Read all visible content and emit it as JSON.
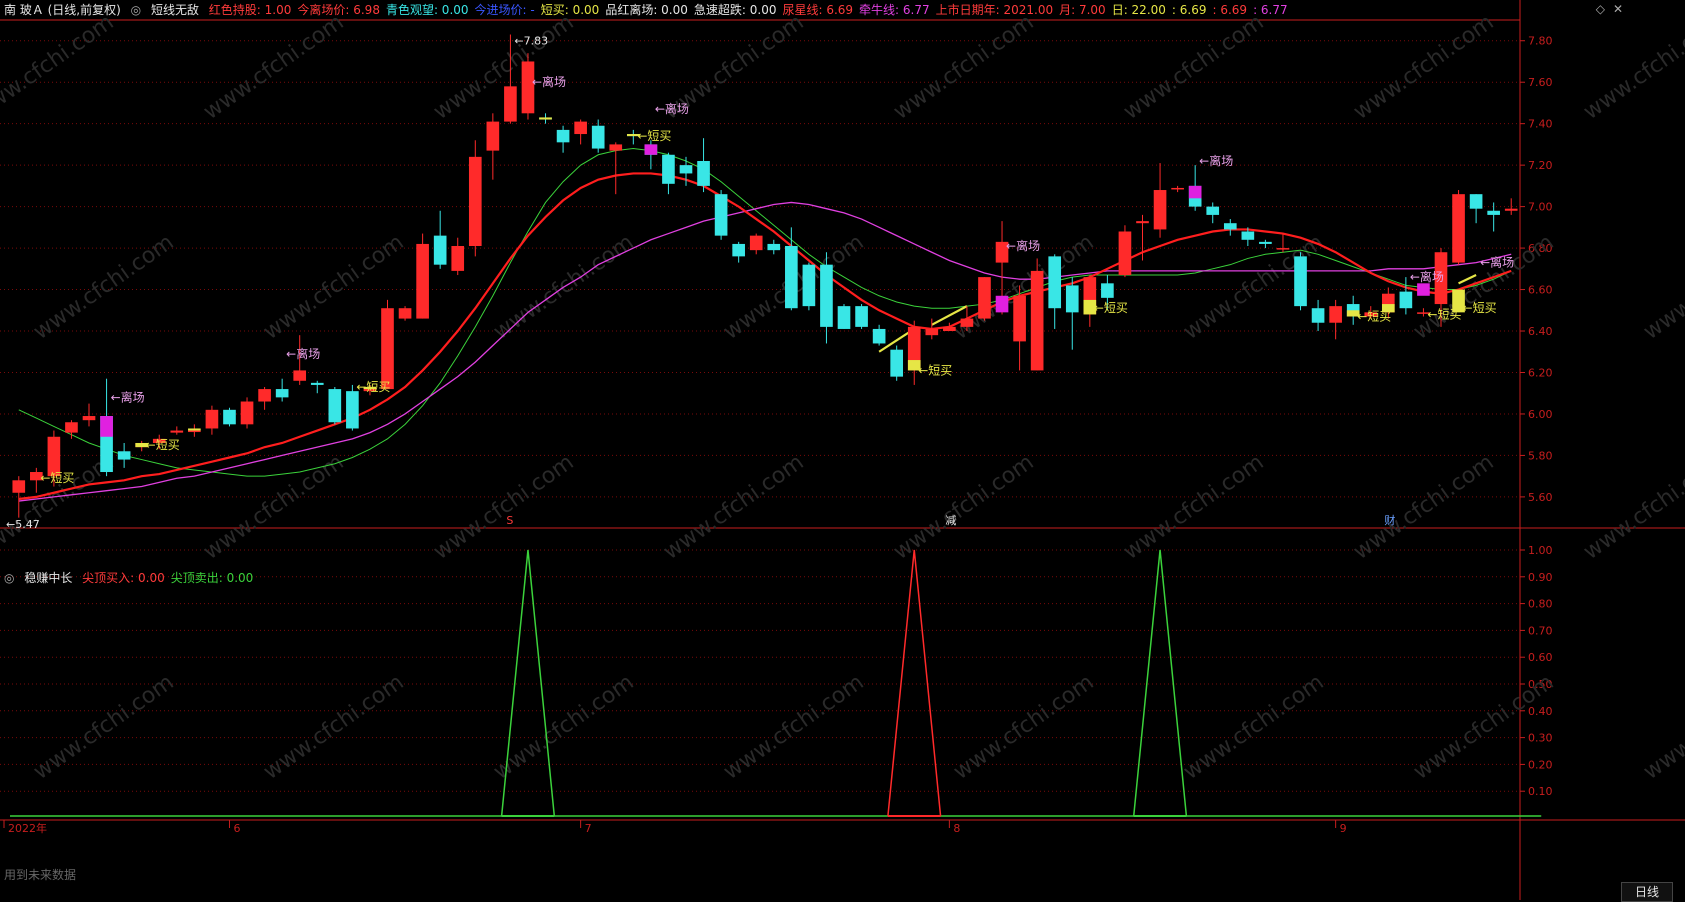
{
  "colors": {
    "bg": "#000000",
    "up": "#ff2a2a",
    "down": "#39e6e6",
    "grid": "#7a0a0a",
    "axis": "#c81e1e",
    "ma_red": "#ff1e1e",
    "ma_magenta": "#e040e0",
    "ma_green": "#3bd23b",
    "gold": "#e6e646",
    "magenta_body": "#e020e0"
  },
  "header": {
    "title": "南 玻Ａ (日线,前复权)",
    "indicator_name": "短线无敌",
    "items": [
      {
        "text": "红色持股: 1.00",
        "color": "#ff3b3b"
      },
      {
        "text": "今离场价: 6.98",
        "color": "#ff3b3b"
      },
      {
        "text": "青色观望: 0.00",
        "color": "#39e6e6"
      },
      {
        "text": "今进场价: -",
        "color": "#3a56ff"
      },
      {
        "text": "短买: 0.00",
        "color": "#e6e646"
      },
      {
        "text": "品红离场: 0.00",
        "color": "#e6e6e6"
      },
      {
        "text": "急速超跌: 0.00",
        "color": "#e6e6e6"
      },
      {
        "text": "尿星线: 6.69",
        "color": "#ff3b3b"
      },
      {
        "text": "牵牛线: 6.77",
        "color": "#e040e0"
      },
      {
        "text": "上市日期年: 2021.00",
        "color": "#ff3b3b"
      },
      {
        "text": "月: 7.00",
        "color": "#ff3b3b"
      },
      {
        "text": "日: 22.00",
        "color": "#e6e646"
      },
      {
        "text": ": 6.69",
        "color": "#e6e646"
      },
      {
        "text": ": 6.69",
        "color": "#ff3b3b"
      },
      {
        "text": ": 6.77",
        "color": "#e040e0"
      }
    ]
  },
  "sub_header": {
    "indicator_name": "稳赚中长",
    "items": [
      {
        "text": "尖顶买入: 0.00",
        "color": "#ff3b3b"
      },
      {
        "text": "尖顶卖出: 0.00",
        "color": "#3bd23b"
      }
    ]
  },
  "main_axis": {
    "ticks": [
      "7.80",
      "7.60",
      "7.40",
      "7.20",
      "7.00",
      "6.80",
      "6.60",
      "6.40",
      "6.20",
      "6.00",
      "5.80",
      "5.60"
    ]
  },
  "sub_axis": {
    "ticks": [
      "1.00",
      "0.90",
      "0.80",
      "0.70",
      "0.60",
      "0.50",
      "0.40",
      "0.30",
      "0.20",
      "0.10"
    ]
  },
  "time_axis": [
    "2022年",
    "6",
    "7",
    "8",
    "9"
  ],
  "period_button": "日线",
  "footer_note": "用到未来数据",
  "watermark": "www.cfchi.com",
  "price_max_label": "7.83",
  "price_min_label": "5.47",
  "event_marks": [
    {
      "text": "S",
      "color": "#ff3b3b"
    },
    {
      "text": "减",
      "color": "#e6e6e6"
    },
    {
      "text": "财",
      "color": "#6aa0ff"
    }
  ],
  "signal_labels": {
    "buy": "←短买",
    "exit": "←离场"
  },
  "chart_data": {
    "type": "candlestick",
    "candles": [
      [
        5.62,
        5.68,
        5.7,
        5.5
      ],
      [
        5.68,
        5.72,
        5.74,
        5.62
      ],
      [
        5.7,
        5.89,
        5.92,
        5.65
      ],
      [
        5.91,
        5.96,
        5.97,
        5.88
      ],
      [
        5.97,
        5.99,
        6.05,
        5.94
      ],
      [
        5.99,
        5.72,
        6.17,
        5.7
      ],
      [
        5.82,
        5.78,
        5.86,
        5.74
      ],
      [
        5.84,
        5.86,
        5.87,
        5.82
      ],
      [
        5.86,
        5.88,
        5.9,
        5.83
      ],
      [
        5.91,
        5.92,
        5.94,
        5.9
      ],
      [
        5.92,
        5.92,
        5.95,
        5.89
      ],
      [
        5.93,
        6.02,
        6.04,
        5.9
      ],
      [
        6.02,
        5.95,
        6.03,
        5.94
      ],
      [
        5.95,
        6.06,
        6.08,
        5.93
      ],
      [
        6.06,
        6.12,
        6.13,
        6.02
      ],
      [
        6.12,
        6.08,
        6.17,
        6.06
      ],
      [
        6.16,
        6.21,
        6.38,
        6.14
      ],
      [
        6.15,
        6.14,
        6.16,
        6.1
      ],
      [
        6.12,
        5.96,
        6.13,
        5.95
      ],
      [
        6.11,
        5.93,
        6.14,
        5.92
      ],
      [
        6.11,
        6.13,
        6.14,
        6.09
      ],
      [
        6.12,
        6.51,
        6.55,
        6.12
      ],
      [
        6.46,
        6.51,
        6.52,
        6.45
      ],
      [
        6.46,
        6.82,
        6.87,
        6.46
      ],
      [
        6.86,
        6.72,
        6.98,
        6.7
      ],
      [
        6.69,
        6.81,
        6.85,
        6.67
      ],
      [
        6.81,
        7.24,
        7.32,
        6.76
      ],
      [
        7.27,
        7.41,
        7.45,
        7.13
      ],
      [
        7.41,
        7.58,
        7.83,
        7.4
      ],
      [
        7.45,
        7.7,
        7.74,
        7.42
      ],
      [
        7.43,
        7.42,
        7.45,
        7.4
      ],
      [
        7.37,
        7.31,
        7.39,
        7.26
      ],
      [
        7.35,
        7.41,
        7.42,
        7.3
      ],
      [
        7.39,
        7.28,
        7.42,
        7.26
      ],
      [
        7.27,
        7.3,
        7.31,
        7.06
      ],
      [
        7.35,
        7.34,
        7.37,
        7.3
      ],
      [
        7.3,
        7.25,
        7.32,
        7.18
      ],
      [
        7.25,
        7.11,
        7.26,
        7.06
      ],
      [
        7.2,
        7.16,
        7.24,
        7.1
      ],
      [
        7.22,
        7.1,
        7.33,
        7.07
      ],
      [
        7.06,
        6.86,
        7.08,
        6.84
      ],
      [
        6.82,
        6.76,
        6.83,
        6.73
      ],
      [
        6.79,
        6.86,
        6.87,
        6.77
      ],
      [
        6.82,
        6.79,
        6.84,
        6.77
      ],
      [
        6.81,
        6.51,
        6.9,
        6.5
      ],
      [
        6.72,
        6.52,
        6.73,
        6.5
      ],
      [
        6.72,
        6.42,
        6.78,
        6.34
      ],
      [
        6.52,
        6.41,
        6.53,
        6.41
      ],
      [
        6.52,
        6.42,
        6.53,
        6.41
      ],
      [
        6.41,
        6.34,
        6.43,
        6.33
      ],
      [
        6.31,
        6.18,
        6.33,
        6.16
      ],
      [
        6.21,
        6.42,
        6.45,
        6.14
      ],
      [
        6.38,
        6.41,
        6.46,
        6.36
      ],
      [
        6.4,
        6.42,
        6.44,
        6.4
      ],
      [
        6.42,
        6.46,
        6.52,
        6.4
      ],
      [
        6.46,
        6.66,
        6.66,
        6.45
      ],
      [
        6.73,
        6.83,
        6.93,
        6.48
      ],
      [
        6.35,
        6.57,
        6.62,
        6.21
      ],
      [
        6.21,
        6.69,
        6.75,
        6.21
      ],
      [
        6.76,
        6.51,
        6.77,
        6.41
      ],
      [
        6.62,
        6.49,
        6.66,
        6.31
      ],
      [
        6.48,
        6.66,
        6.67,
        6.42
      ],
      [
        6.63,
        6.56,
        6.67,
        6.5
      ],
      [
        6.67,
        6.88,
        6.91,
        6.66
      ],
      [
        6.92,
        6.93,
        6.96,
        6.74
      ],
      [
        6.89,
        7.08,
        7.21,
        6.85
      ],
      [
        7.09,
        7.09,
        7.1,
        7.07
      ],
      [
        7.1,
        7.0,
        7.2,
        6.98
      ],
      [
        7.0,
        6.96,
        7.02,
        6.92
      ],
      [
        6.92,
        6.89,
        6.94,
        6.86
      ],
      [
        6.88,
        6.84,
        6.9,
        6.81
      ],
      [
        6.83,
        6.82,
        6.84,
        6.8
      ],
      [
        6.8,
        6.8,
        6.87,
        6.78
      ],
      [
        6.76,
        6.52,
        6.78,
        6.5
      ],
      [
        6.51,
        6.44,
        6.55,
        6.4
      ],
      [
        6.44,
        6.52,
        6.55,
        6.36
      ],
      [
        6.53,
        6.47,
        6.57,
        6.43
      ],
      [
        6.47,
        6.49,
        6.52,
        6.46
      ],
      [
        6.49,
        6.58,
        6.61,
        6.46
      ],
      [
        6.59,
        6.51,
        6.66,
        6.48
      ],
      [
        6.49,
        6.49,
        6.51,
        6.47
      ],
      [
        6.53,
        6.78,
        6.8,
        6.42
      ],
      [
        6.73,
        7.06,
        7.08,
        6.72
      ],
      [
        7.06,
        6.99,
        7.06,
        6.92
      ],
      [
        6.98,
        6.96,
        7.02,
        6.88
      ],
      [
        6.98,
        6.99,
        7.04,
        6.96
      ]
    ],
    "highlights": [
      {
        "i": 5,
        "color": "magenta",
        "top": 5.99,
        "bot": 5.89
      },
      {
        "i": 7,
        "color": "gold",
        "top": 5.86,
        "bot": 5.84
      },
      {
        "i": 10,
        "color": "gold",
        "top": 5.93,
        "bot": 5.92
      },
      {
        "i": 20,
        "color": "gold",
        "top": 6.13,
        "bot": 6.12
      },
      {
        "i": 30,
        "color": "gold",
        "top": 7.43,
        "bot": 7.42
      },
      {
        "i": 35,
        "color": "gold",
        "top": 7.35,
        "bot": 7.34
      },
      {
        "i": 36,
        "color": "magenta",
        "top": 7.3,
        "bot": 7.25
      },
      {
        "i": 51,
        "color": "gold",
        "top": 6.26,
        "bot": 6.21
      },
      {
        "i": 56,
        "color": "magenta",
        "top": 6.57,
        "bot": 6.49
      },
      {
        "i": 61,
        "color": "gold",
        "top": 6.55,
        "bot": 6.48
      },
      {
        "i": 67,
        "color": "magenta",
        "top": 7.1,
        "bot": 7.04
      },
      {
        "i": 76,
        "color": "gold",
        "top": 6.5,
        "bot": 6.47
      },
      {
        "i": 78,
        "color": "gold",
        "top": 6.53,
        "bot": 6.49
      },
      {
        "i": 80,
        "color": "magenta",
        "top": 6.63,
        "bot": 6.57
      },
      {
        "i": 82,
        "color": "gold",
        "top": 6.6,
        "bot": 6.49
      }
    ],
    "ma_red": [
      5.58,
      5.62,
      5.65,
      5.68,
      5.7,
      5.74,
      5.77,
      5.8,
      5.83,
      5.86,
      5.9,
      5.94,
      5.98,
      6.01,
      6.05,
      6.1,
      6.15,
      6.2,
      6.27,
      6.36,
      6.46,
      6.57,
      6.68,
      6.79,
      6.88,
      6.96,
      7.03,
      7.09,
      7.13,
      7.16,
      7.18,
      7.18,
      7.16,
      7.13,
      7.08,
      7.0,
      6.92,
      6.84,
      6.76,
      6.7,
      6.64,
      6.58,
      6.53,
      6.48,
      6.46,
      6.47,
      6.49,
      6.52,
      6.55,
      6.59,
      6.63,
      6.67,
      6.71,
      6.74,
      6.76,
      6.77,
      6.79,
      6.79,
      6.78,
      6.77,
      6.76,
      6.74,
      6.72,
      6.7,
      6.69
    ],
    "ma_red_x": [
      0,
      3,
      6,
      9,
      12,
      14,
      16,
      18,
      20,
      21,
      22,
      23,
      24,
      25,
      26,
      27,
      28,
      29,
      30,
      31,
      32,
      33,
      34,
      35,
      36,
      37,
      38,
      39,
      40,
      41,
      42,
      43,
      44,
      45,
      46,
      47,
      48,
      49,
      50,
      51,
      52,
      53,
      54,
      55,
      56,
      57,
      58,
      59,
      60,
      61,
      62,
      63,
      64,
      65,
      66,
      67,
      68,
      69,
      70,
      71,
      72,
      73,
      74,
      75,
      76
    ],
    "ma_red_full": [
      5.59,
      5.6,
      5.62,
      5.64,
      5.66,
      5.67,
      5.68,
      5.7,
      5.71,
      5.73,
      5.75,
      5.77,
      5.79,
      5.81,
      5.84,
      5.86,
      5.89,
      5.92,
      5.95,
      5.98,
      6.02,
      6.07,
      6.13,
      6.21,
      6.3,
      6.4,
      6.51,
      6.63,
      6.75,
      6.86,
      6.95,
      7.03,
      7.09,
      7.13,
      7.15,
      7.16,
      7.16,
      7.15,
      7.13,
      7.1,
      7.05,
      7.0,
      6.94,
      6.88,
      6.81,
      6.74,
      6.67,
      6.61,
      6.55,
      6.5,
      6.46,
      6.42,
      6.41,
      6.42,
      6.46,
      6.5,
      6.54,
      6.57,
      6.59,
      6.61,
      6.63,
      6.66,
      6.7,
      6.74,
      6.78,
      6.81,
      6.84,
      6.86,
      6.88,
      6.89,
      6.89,
      6.88,
      6.87,
      6.85,
      6.82,
      6.78,
      6.73,
      6.68,
      6.64,
      6.61,
      6.59,
      6.58,
      6.6,
      6.63,
      6.66,
      6.69
    ],
    "ma_magenta": [
      5.58,
      5.59,
      5.6,
      5.61,
      5.62,
      5.63,
      5.64,
      5.65,
      5.67,
      5.69,
      5.7,
      5.72,
      5.74,
      5.76,
      5.78,
      5.8,
      5.82,
      5.84,
      5.86,
      5.88,
      5.91,
      5.95,
      6.0,
      6.06,
      6.12,
      6.18,
      6.25,
      6.33,
      6.41,
      6.49,
      6.55,
      6.61,
      6.66,
      6.72,
      6.76,
      6.8,
      6.84,
      6.87,
      6.9,
      6.93,
      6.95,
      6.97,
      6.99,
      7.01,
      7.02,
      7.01,
      6.99,
      6.97,
      6.94,
      6.9,
      6.86,
      6.82,
      6.78,
      6.74,
      6.71,
      6.68,
      6.66,
      6.65,
      6.65,
      6.66,
      6.67,
      6.68,
      6.69,
      6.69,
      6.69,
      6.69,
      6.69,
      6.69,
      6.69,
      6.69,
      6.69,
      6.69,
      6.69,
      6.69,
      6.69,
      6.69,
      6.69,
      6.69,
      6.7,
      6.7,
      6.7,
      6.71,
      6.72,
      6.73,
      6.75,
      6.77
    ],
    "ma_green": [
      6.02,
      5.98,
      5.94,
      5.9,
      5.86,
      5.83,
      5.8,
      5.78,
      5.76,
      5.74,
      5.73,
      5.72,
      5.71,
      5.7,
      5.7,
      5.71,
      5.72,
      5.74,
      5.76,
      5.79,
      5.83,
      5.88,
      5.95,
      6.04,
      6.15,
      6.28,
      6.42,
      6.57,
      6.73,
      6.88,
      7.02,
      7.12,
      7.2,
      7.25,
      7.27,
      7.28,
      7.27,
      7.25,
      7.22,
      7.18,
      7.12,
      7.05,
      6.98,
      6.91,
      6.84,
      6.77,
      6.71,
      6.66,
      6.61,
      6.57,
      6.54,
      6.52,
      6.51,
      6.51,
      6.52,
      6.53,
      6.55,
      6.58,
      6.61,
      6.64,
      6.66,
      6.67,
      6.67,
      6.67,
      6.67,
      6.67,
      6.67,
      6.68,
      6.7,
      6.72,
      6.75,
      6.77,
      6.78,
      6.79,
      6.77,
      6.74,
      6.71,
      6.68,
      6.65,
      6.62,
      6.61,
      6.6,
      6.6,
      6.62,
      6.65,
      6.69
    ],
    "ma_red_x_note": "",
    "buy_signals": [
      {
        "i": 1,
        "y": 5.69
      },
      {
        "i": 7,
        "y": 5.85
      },
      {
        "i": 19,
        "y": 6.13
      },
      {
        "i": 35,
        "y": 7.34
      },
      {
        "i": 51,
        "y": 6.21
      },
      {
        "i": 61,
        "y": 6.51
      },
      {
        "i": 76,
        "y": 6.47
      },
      {
        "i": 80,
        "y": 6.48
      },
      {
        "i": 82,
        "y": 6.51
      }
    ],
    "exit_signals": [
      {
        "i": 5,
        "y": 6.08
      },
      {
        "i": 15,
        "y": 6.29
      },
      {
        "i": 29,
        "y": 7.6
      },
      {
        "i": 36,
        "y": 7.47
      },
      {
        "i": 56,
        "y": 6.81
      },
      {
        "i": 67,
        "y": 7.22
      },
      {
        "i": 79,
        "y": 6.66
      },
      {
        "i": 83,
        "y": 6.73
      }
    ],
    "gold_segments": [
      [
        [
          49,
          6.3
        ],
        [
          51,
          6.41
        ]
      ],
      [
        [
          52,
          6.43
        ],
        [
          54,
          6.52
        ]
      ],
      [
        [
          82,
          6.63
        ],
        [
          83,
          6.67
        ]
      ]
    ],
    "event_marks_x": [
      28,
      53,
      78
    ],
    "sub": {
      "baseline": 0,
      "green_peaks": [
        29,
        65
      ],
      "red_peaks": [
        51
      ],
      "ylim": [
        0,
        1
      ]
    },
    "xlim": [
      0,
      85
    ],
    "ylim": [
      5.45,
      7.9
    ]
  }
}
